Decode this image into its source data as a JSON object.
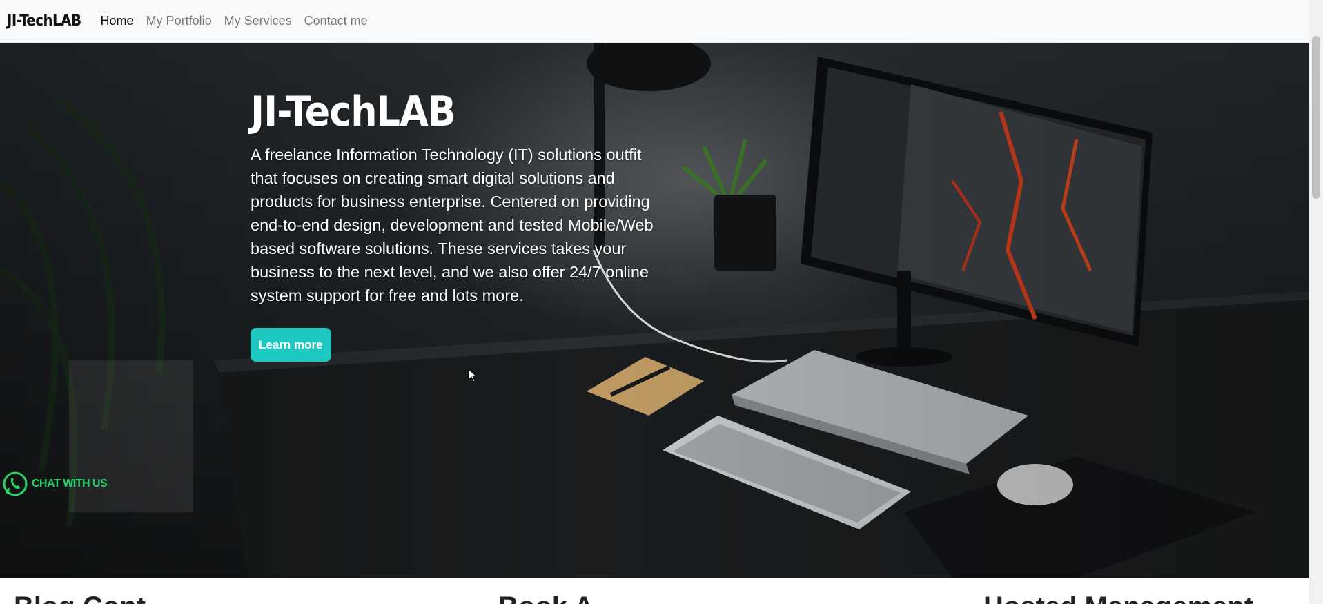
{
  "navbar": {
    "brand": "JI-TechLAB",
    "links": [
      {
        "label": "Home",
        "active": true
      },
      {
        "label": "My Portfolio",
        "active": false
      },
      {
        "label": "My Services",
        "active": false
      },
      {
        "label": "Contact me",
        "active": false
      }
    ]
  },
  "hero": {
    "title": "JI-TechLAB",
    "description": "A freelance Information Technology (IT) solutions outfit that focuses on creating smart digital solutions and products for business enterprise. Centered on providing end-to-end design, development and tested Mobile/Web based software solutions. These services takes your business to the next level, and we also offer 24/7 online system support for free and lots more.",
    "button_label": "Learn more",
    "button_color": "#1ec8c0"
  },
  "chat_widget": {
    "label": "CHAT WITH US",
    "icon": "whatsapp-icon",
    "color": "#25d366"
  },
  "features": {
    "titles": [
      "Blog Cont",
      "Book A",
      "Hosted Management"
    ]
  }
}
